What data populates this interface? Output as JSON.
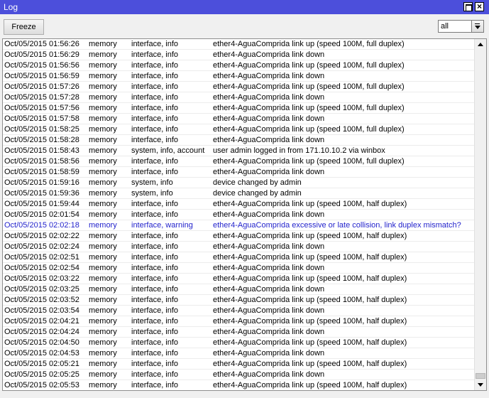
{
  "window": {
    "title": "Log"
  },
  "toolbar": {
    "freeze_label": "Freeze",
    "filter_value": "all"
  },
  "log": {
    "rows": [
      {
        "time": "Oct/05/2015 01:56:26",
        "buffer": "memory",
        "topics": "interface, info",
        "message": "ether4-AguaComprida link up (speed 100M, full duplex)"
      },
      {
        "time": "Oct/05/2015 01:56:29",
        "buffer": "memory",
        "topics": "interface, info",
        "message": "ether4-AguaComprida link down"
      },
      {
        "time": "Oct/05/2015 01:56:56",
        "buffer": "memory",
        "topics": "interface, info",
        "message": "ether4-AguaComprida link up (speed 100M, full duplex)"
      },
      {
        "time": "Oct/05/2015 01:56:59",
        "buffer": "memory",
        "topics": "interface, info",
        "message": "ether4-AguaComprida link down"
      },
      {
        "time": "Oct/05/2015 01:57:26",
        "buffer": "memory",
        "topics": "interface, info",
        "message": "ether4-AguaComprida link up (speed 100M, full duplex)"
      },
      {
        "time": "Oct/05/2015 01:57:28",
        "buffer": "memory",
        "topics": "interface, info",
        "message": "ether4-AguaComprida link down"
      },
      {
        "time": "Oct/05/2015 01:57:56",
        "buffer": "memory",
        "topics": "interface, info",
        "message": "ether4-AguaComprida link up (speed 100M, full duplex)"
      },
      {
        "time": "Oct/05/2015 01:57:58",
        "buffer": "memory",
        "topics": "interface, info",
        "message": "ether4-AguaComprida link down"
      },
      {
        "time": "Oct/05/2015 01:58:25",
        "buffer": "memory",
        "topics": "interface, info",
        "message": "ether4-AguaComprida link up (speed 100M, full duplex)"
      },
      {
        "time": "Oct/05/2015 01:58:28",
        "buffer": "memory",
        "topics": "interface, info",
        "message": "ether4-AguaComprida link down"
      },
      {
        "time": "Oct/05/2015 01:58:43",
        "buffer": "memory",
        "topics": "system, info, account",
        "message": "user admin logged in from 171.10.10.2 via winbox"
      },
      {
        "time": "Oct/05/2015 01:58:56",
        "buffer": "memory",
        "topics": "interface, info",
        "message": "ether4-AguaComprida link up (speed 100M, full duplex)"
      },
      {
        "time": "Oct/05/2015 01:58:59",
        "buffer": "memory",
        "topics": "interface, info",
        "message": "ether4-AguaComprida link down"
      },
      {
        "time": "Oct/05/2015 01:59:16",
        "buffer": "memory",
        "topics": "system, info",
        "message": "device changed by admin"
      },
      {
        "time": "Oct/05/2015 01:59:36",
        "buffer": "memory",
        "topics": "system, info",
        "message": "device changed by admin"
      },
      {
        "time": "Oct/05/2015 01:59:44",
        "buffer": "memory",
        "topics": "interface, info",
        "message": "ether4-AguaComprida link up (speed 100M, half duplex)"
      },
      {
        "time": "Oct/05/2015 02:01:54",
        "buffer": "memory",
        "topics": "interface, info",
        "message": "ether4-AguaComprida link down"
      },
      {
        "time": "Oct/05/2015 02:02:18",
        "buffer": "memory",
        "topics": "interface, warning",
        "message": "ether4-AguaComprida excessive or late collision, link duplex mismatch?",
        "warning": true
      },
      {
        "time": "Oct/05/2015 02:02:22",
        "buffer": "memory",
        "topics": "interface, info",
        "message": "ether4-AguaComprida link up (speed 100M, half duplex)"
      },
      {
        "time": "Oct/05/2015 02:02:24",
        "buffer": "memory",
        "topics": "interface, info",
        "message": "ether4-AguaComprida link down"
      },
      {
        "time": "Oct/05/2015 02:02:51",
        "buffer": "memory",
        "topics": "interface, info",
        "message": "ether4-AguaComprida link up (speed 100M, half duplex)"
      },
      {
        "time": "Oct/05/2015 02:02:54",
        "buffer": "memory",
        "topics": "interface, info",
        "message": "ether4-AguaComprida link down"
      },
      {
        "time": "Oct/05/2015 02:03:22",
        "buffer": "memory",
        "topics": "interface, info",
        "message": "ether4-AguaComprida link up (speed 100M, half duplex)"
      },
      {
        "time": "Oct/05/2015 02:03:25",
        "buffer": "memory",
        "topics": "interface, info",
        "message": "ether4-AguaComprida link down"
      },
      {
        "time": "Oct/05/2015 02:03:52",
        "buffer": "memory",
        "topics": "interface, info",
        "message": "ether4-AguaComprida link up (speed 100M, half duplex)"
      },
      {
        "time": "Oct/05/2015 02:03:54",
        "buffer": "memory",
        "topics": "interface, info",
        "message": "ether4-AguaComprida link down"
      },
      {
        "time": "Oct/05/2015 02:04:21",
        "buffer": "memory",
        "topics": "interface, info",
        "message": "ether4-AguaComprida link up (speed 100M, half duplex)"
      },
      {
        "time": "Oct/05/2015 02:04:24",
        "buffer": "memory",
        "topics": "interface, info",
        "message": "ether4-AguaComprida link down"
      },
      {
        "time": "Oct/05/2015 02:04:50",
        "buffer": "memory",
        "topics": "interface, info",
        "message": "ether4-AguaComprida link up (speed 100M, half duplex)"
      },
      {
        "time": "Oct/05/2015 02:04:53",
        "buffer": "memory",
        "topics": "interface, info",
        "message": "ether4-AguaComprida link down"
      },
      {
        "time": "Oct/05/2015 02:05:21",
        "buffer": "memory",
        "topics": "interface, info",
        "message": "ether4-AguaComprida link up (speed 100M, half duplex)"
      },
      {
        "time": "Oct/05/2015 02:05:25",
        "buffer": "memory",
        "topics": "interface, info",
        "message": "ether4-AguaComprida link down"
      },
      {
        "time": "Oct/05/2015 02:05:53",
        "buffer": "memory",
        "topics": "interface, info",
        "message": "ether4-AguaComprida link up (speed 100M, half duplex)"
      }
    ]
  },
  "colors": {
    "titlebar": "#4c4fdb",
    "warning_text": "#2323cc"
  },
  "icons": {
    "maximize": "maximize-icon",
    "close": "close-icon",
    "dropdown": "dropdown-arrow-icon"
  }
}
